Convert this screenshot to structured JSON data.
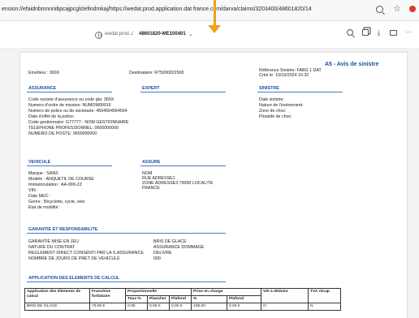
{
  "browser": {
    "url": "ension://efaidnbmnnnibpcajpcglclefindmkaj/https://wedat.prod.application.dat france.com/darva/claims/3203400/48601820/14",
    "actions": [
      "zoom-icon",
      "star-icon",
      "recording-dot-icon"
    ]
  },
  "pdf_toolbar": {
    "site": "wedat.prod...",
    "separator": "/",
    "file": "48601820-ME100401",
    "chevron": "⌄",
    "tools": [
      "search-icon",
      "copy-icon",
      "download-icon",
      "print-icon",
      "more-icon"
    ]
  },
  "doc": {
    "title": "A5 - Avis de sinistre",
    "emetteur": "Emetteur : 369X",
    "destinataire": "Destinataire: R75000022500",
    "reference": "Référence Sinistre: FABG 1 DAT",
    "cree": "Créé le: 10/10/2024 15:32",
    "sections": {
      "assurance": "ASSURANCE",
      "expert": "EXPERT",
      "sinistre": "SINISTRE",
      "vehicule": "VEHICULE",
      "assure": "ASSURE",
      "garantie": "GARANTIE ET RESPONSABILITE",
      "application": "APPLICATION DES ELEMENTS DE CALCUL"
    },
    "assurance_lines": [
      "Code societe d'assurance ou code gta: 369X",
      "Numero d'ordre de mission: NUMOM00016",
      "Numero de police ou de societaire: 4564564564564",
      "Date d'effet de la police:",
      "Code gestionnaire: G77777 - NOM GESTIONNAIRE",
      "TELEPHONE PROFESSIONNEL: 0600000000",
      "NUMERO DE POSTE: 0600000000"
    ],
    "sinistre_lines": [
      "Date sinistre:",
      "Nature de l'événement:",
      "Zone de choc:",
      "Pluralité de choc:"
    ],
    "vehicule_lines": [
      "Marque : SANS",
      "Modèle : ANQUETIL DE COURSE",
      "Immatriculation : AA-999-ZZ",
      "VIN :",
      "Date MEC :",
      "Genre : Bicyclette, cycle, velo",
      "Etat de mobilité :"
    ],
    "assure_lines": [
      "NOM",
      "RUE ADRESSE1",
      "ZONE ADRESSE3 79000 LOCALITE",
      "FRANCE"
    ],
    "garantie_rows": [
      [
        "GARANTIE MISE EN JEU",
        "BRIS DE GLACE"
      ],
      [
        "NATURE DU CONTRAT",
        "ASSURANCE DOMMAGE"
      ],
      [
        "REGLEMENT DIRECT CONSENTI PAR LA S.ASSURANCE",
        "DELIVRE"
      ],
      [
        "NOMBRE DE JOURS DE PRET DE VEHICULE",
        "000"
      ]
    ],
    "table": {
      "h1": [
        "Application des éléments de calcul",
        "Franchise forfaitaire",
        "Proportionnelle",
        "Prise en charge",
        "Vét à déduire",
        "TVA récup"
      ],
      "h2": [
        "Taux %",
        "Plancher",
        "Plafond",
        "%",
        "Plafond"
      ],
      "row": [
        "BRIS DE GLACE",
        "75.00 €",
        "0.00",
        "0.00 €",
        "0.00 €",
        "100.00",
        "0.00 €",
        "O",
        "N"
      ]
    }
  }
}
